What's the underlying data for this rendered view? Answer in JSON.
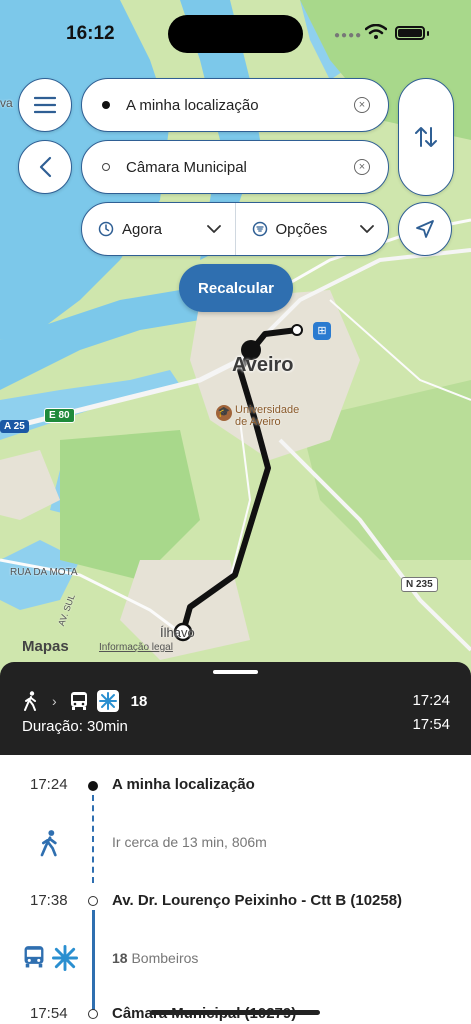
{
  "status_bar": {
    "time": "16:12"
  },
  "map": {
    "city": "Aveiro",
    "poi": "Universidade de Aveiro",
    "poi_line1": "Universidade",
    "poi_line2": "de Aveiro",
    "street": "RUA DA MOTA",
    "street2": "AV. SUL",
    "town": "Ílhavo",
    "road_a25": "A 25",
    "road_e80": "E 80",
    "road_n235": "N 235",
    "maps_brand": "Mapas",
    "legal": "Informação legal",
    "edge_text": "va"
  },
  "search": {
    "origin": "A minha localização",
    "destination": "Câmara Municipal",
    "time_option": "Agora",
    "options_label": "Opções",
    "recalc_label": "Recalcular"
  },
  "summary": {
    "route_number": "18",
    "duration": "Duração: 30min",
    "depart": "17:24",
    "arrive": "17:54"
  },
  "timeline": {
    "stops": [
      {
        "time": "17:24",
        "name": "A minha localização"
      },
      {
        "time": "17:38",
        "name": "Av. Dr. Lourenço Peixinho - Ctt B (10258)"
      },
      {
        "time": "17:54",
        "name": "Câmara Municipal (10279)"
      }
    ],
    "walk_text": "Ir cerca de 13 min, 806m",
    "bus_route": "18",
    "bus_headsign": "Bombeiros"
  },
  "colors": {
    "accent": "#2f6fb0",
    "panel_dark": "#222222",
    "water": "#6fc3e6",
    "land": "#c9e3a8"
  }
}
